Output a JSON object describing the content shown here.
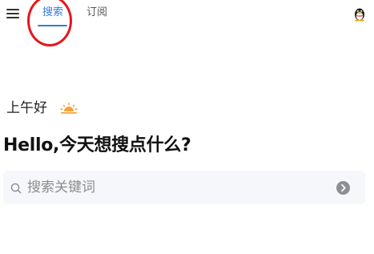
{
  "header": {
    "menu_icon": "menu-icon",
    "tabs": [
      {
        "label": "搜索",
        "active": true
      },
      {
        "label": "订阅",
        "active": false
      }
    ],
    "account_icon": "qq-penguin-icon",
    "accent_color": "#3a7bd5",
    "highlight_color": "#e8141b"
  },
  "main": {
    "greeting": "上午好",
    "greeting_icon": "sunrise-icon",
    "headline": "Hello,今天想搜点什么?",
    "search": {
      "placeholder": "搜索关键词",
      "value": "",
      "search_icon": "search-icon",
      "go_icon": "arrow-right-circle-icon"
    }
  }
}
